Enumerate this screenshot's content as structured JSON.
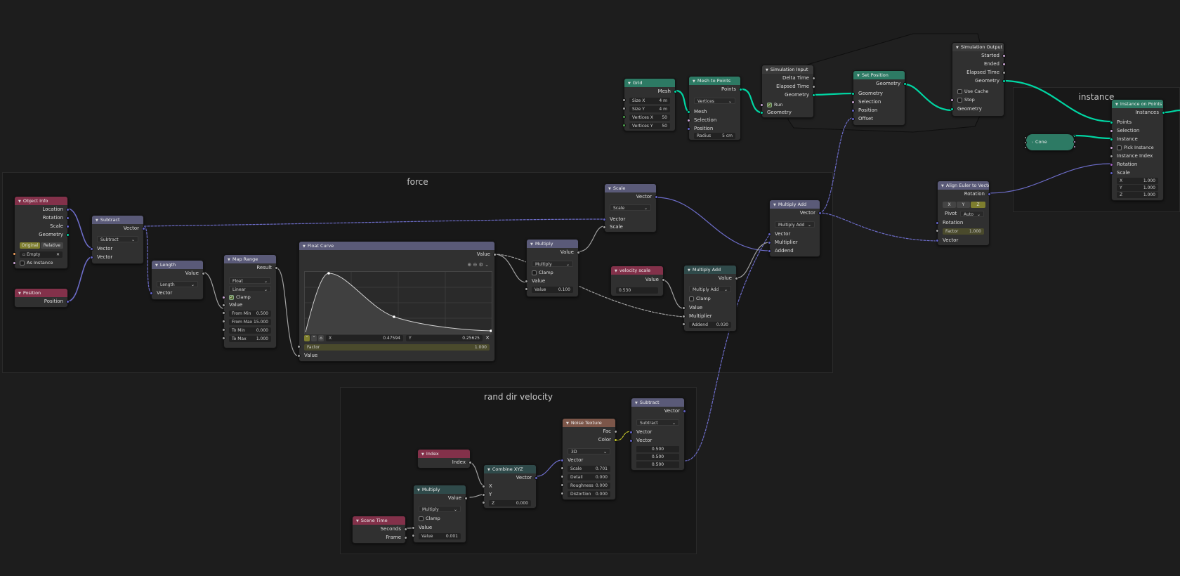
{
  "frames": {
    "force": "force",
    "instance": "instance",
    "rand_dir": "rand dir velocity"
  },
  "colors": {
    "geometry_header": "#2d7a64",
    "input_header": "#83314a",
    "converter_header": "#5a5a78",
    "vector_header": "#2f4a4a",
    "texture_header": "#7c5649",
    "geometry_socket": "#00d6a3",
    "vector_socket": "#6363c7",
    "float_socket": "#a1a1a1",
    "color_socket": "#c7c729"
  },
  "nodes": {
    "grid": {
      "title": "Grid",
      "out_mesh": "Mesh",
      "size_x_label": "Size X",
      "size_x": "4 m",
      "size_y_label": "Size Y",
      "size_y": "4 m",
      "vx_label": "Vertices X",
      "vx": "50",
      "vy_label": "Vertices Y",
      "vy": "50"
    },
    "mesh_to_points": {
      "title": "Mesh to Points",
      "out_points": "Points",
      "mode": "Vertices",
      "in_mesh": "Mesh",
      "in_selection": "Selection",
      "in_position": "Position",
      "radius_label": "Radius",
      "radius": "5 cm"
    },
    "sim_input": {
      "title": "Simulation Input",
      "out_delta": "Delta Time",
      "out_elapsed": "Elapsed Time",
      "out_geometry": "Geometry",
      "run": "Run",
      "in_geometry": "Geometry"
    },
    "set_position": {
      "title": "Set Position",
      "out_geometry": "Geometry",
      "in_geometry": "Geometry",
      "in_selection": "Selection",
      "in_position": "Position",
      "in_offset": "Offset"
    },
    "sim_output": {
      "title": "Simulation Output",
      "out_started": "Started",
      "out_ended": "Ended",
      "out_elapsed": "Elapsed Time",
      "out_geometry": "Geometry",
      "use_cache": "Use Cache",
      "stop": "Stop",
      "in_geometry": "Geometry"
    },
    "instance_on_points": {
      "title": "Instance on Points",
      "out_instances": "Instances",
      "in_points": "Points",
      "in_selection": "Selection",
      "in_instance": "Instance",
      "pick_instance": "Pick Instance",
      "in_instance_index": "Instance Index",
      "in_rotation": "Rotation",
      "in_scale": "Scale",
      "x_label": "X",
      "x": "1.000",
      "y_label": "Y",
      "y": "1.000",
      "z_label": "Z",
      "z": "1.000"
    },
    "cone": {
      "title": "Cone"
    },
    "align_euler": {
      "title": "Align Euler to Vector",
      "out_rotation": "Rotation",
      "ax_x": "X",
      "ax_y": "Y",
      "ax_z": "Z",
      "pivot_label": "Pivot",
      "pivot": "Auto",
      "in_rotation": "Rotation",
      "factor_label": "Factor",
      "factor": "1.000",
      "in_vector": "Vector"
    },
    "object_info": {
      "title": "Object Info",
      "out_location": "Location",
      "out_rotation": "Rotation",
      "out_scale": "Scale",
      "out_geometry": "Geometry",
      "original": "Original",
      "relative": "Relative",
      "object": "Empty",
      "as_instance": "As Instance"
    },
    "position": {
      "title": "Position",
      "out_position": "Position"
    },
    "subtract1": {
      "title": "Subtract",
      "out_vector": "Vector",
      "op": "Subtract",
      "in_a": "Vector",
      "in_b": "Vector"
    },
    "length": {
      "title": "Length",
      "out_value": "Value",
      "op": "Length",
      "in_vector": "Vector"
    },
    "map_range": {
      "title": "Map Range",
      "out_result": "Result",
      "dtype": "Float",
      "interp": "Linear",
      "clamp": "Clamp",
      "in_value": "Value",
      "from_min_label": "From Min",
      "from_min": "0.500",
      "from_max_label": "From Max",
      "from_max": "15.000",
      "to_min_label": "To Min",
      "to_min": "0.000",
      "to_max_label": "To Max",
      "to_max": "1.000"
    },
    "float_curve": {
      "title": "Float Curve",
      "out_value": "Value",
      "x_label": "X",
      "x": "0.47594",
      "y_label": "Y",
      "y": "0.25625",
      "factor_label": "Factor",
      "factor": "1.000",
      "in_value": "Value"
    },
    "multiply1": {
      "title": "Multiply",
      "out_value": "Value",
      "op": "Multiply",
      "clamp": "Clamp",
      "in_value": "Value",
      "value_label": "Value",
      "value": "0.100"
    },
    "scale": {
      "title": "Scale",
      "out_vector": "Vector",
      "op": "Scale",
      "in_vector": "Vector",
      "in_scale": "Scale"
    },
    "velocity_scale": {
      "title": "velocity scale",
      "out_value": "Value",
      "value": "0.530"
    },
    "multiply_add1": {
      "title": "Multiply Add",
      "out_value": "Value",
      "op": "Multiply Add",
      "clamp": "Clamp",
      "in_value": "Value",
      "in_multiplier": "Multiplier",
      "addend_label": "Addend",
      "addend": "0.030"
    },
    "multiply_add2": {
      "title": "Multiply Add",
      "out_vector": "Vector",
      "op": "Multiply Add",
      "in_vector": "Vector",
      "in_multiplier": "Multiplier",
      "in_addend": "Addend"
    },
    "index": {
      "title": "Index",
      "out_index": "Index"
    },
    "scene_time": {
      "title": "Scene Time",
      "out_seconds": "Seconds",
      "out_frame": "Frame"
    },
    "multiply2": {
      "title": "Multiply",
      "out_value": "Value",
      "op": "Multiply",
      "clamp": "Clamp",
      "in_value": "Value",
      "value_label": "Value",
      "value": "0.001"
    },
    "combine_xyz": {
      "title": "Combine XYZ",
      "out_vector": "Vector",
      "in_x": "X",
      "in_y": "Y",
      "z_label": "Z",
      "z": "0.000"
    },
    "noise_texture": {
      "title": "Noise Texture",
      "out_fac": "Fac",
      "out_color": "Color",
      "dim": "3D",
      "in_vector": "Vector",
      "scale_label": "Scale",
      "scale": "0.701",
      "detail_label": "Detail",
      "detail": "0.000",
      "rough_label": "Roughness",
      "rough": "0.000",
      "dist_label": "Distortion",
      "dist": "0.000"
    },
    "subtract2": {
      "title": "Subtract",
      "out_vector": "Vector",
      "op": "Subtract",
      "in_a": "Vector",
      "in_b": "Vector",
      "b1": "0.500",
      "b2": "0.500",
      "b3": "0.500"
    }
  }
}
